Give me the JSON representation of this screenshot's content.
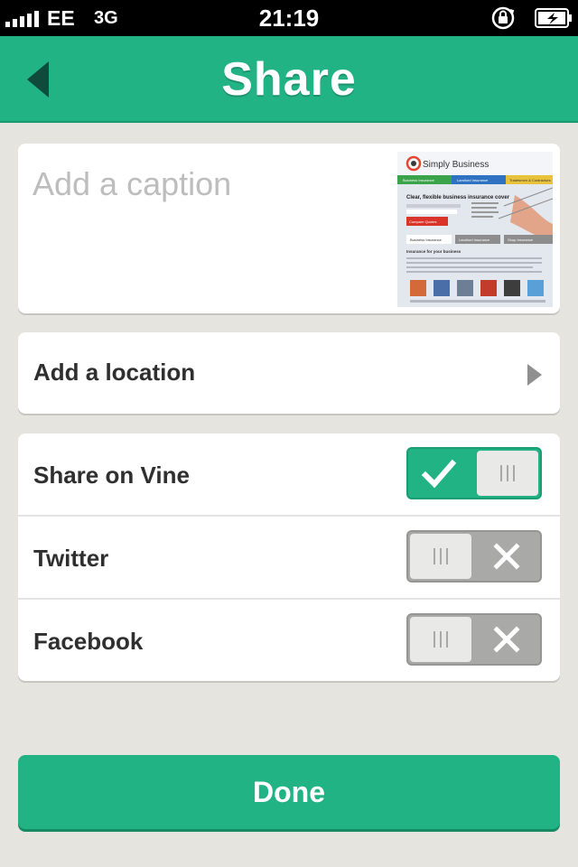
{
  "status_bar": {
    "carrier": "EE",
    "network": "3G",
    "time": "21:19"
  },
  "nav": {
    "title": "Share",
    "back_icon": "back-arrow-icon"
  },
  "caption": {
    "placeholder": "Add a caption",
    "value": ""
  },
  "thumbnail": {
    "brand": "Simply Business",
    "tabs": [
      "Business Insurance",
      "Landlord Insurance",
      "Tradesmen & Contractors"
    ],
    "headline": "Clear, flexible business insurance cover",
    "cta": "Compare Quotes",
    "sub_tabs": [
      "Business Insurance",
      "Landlord Insurance",
      "Shop Insurance"
    ],
    "section_heading": "Insurance for your business"
  },
  "location": {
    "label": "Add a location",
    "icon": "chevron-right-icon"
  },
  "share_options": [
    {
      "label": "Share on Vine",
      "enabled": true
    },
    {
      "label": "Twitter",
      "enabled": false
    },
    {
      "label": "Facebook",
      "enabled": false
    }
  ],
  "done": {
    "label": "Done"
  },
  "colors": {
    "accent": "#21b384",
    "background": "#e6e4de",
    "toggle_off": "#a9a9a7"
  }
}
